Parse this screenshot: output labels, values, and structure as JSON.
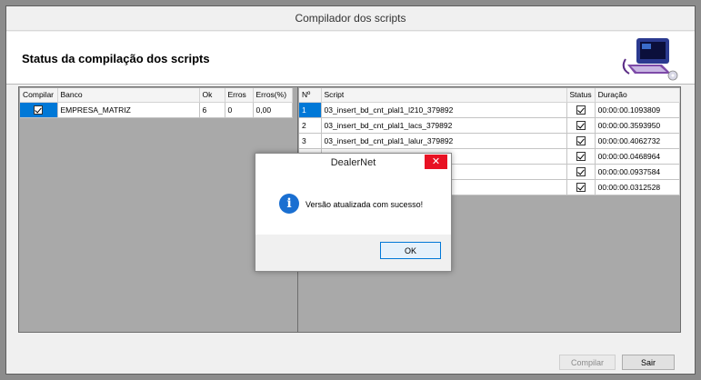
{
  "window": {
    "title": "Compilador dos scripts",
    "header_title": "Status da compilação dos scripts"
  },
  "banks_table": {
    "headers": [
      "Compilar",
      "Banco",
      "Ok",
      "Erros",
      "Erros(%)"
    ],
    "rows": [
      {
        "compilar": true,
        "banco": "EMPRESA_MATRIZ",
        "ok": "6",
        "erros": "0",
        "erros_pct": "0,00"
      }
    ]
  },
  "scripts_table": {
    "headers": [
      "Nº",
      "Script",
      "Status",
      "Duração"
    ],
    "rows": [
      {
        "n": "1",
        "script": "03_insert_bd_cnt_plal1_l210_379892",
        "status": true,
        "duracao": "00:00:00.1093809"
      },
      {
        "n": "2",
        "script": "03_insert_bd_cnt_plal1_lacs_379892",
        "status": true,
        "duracao": "00:00:00.3593950"
      },
      {
        "n": "3",
        "script": "03_insert_bd_cnt_plal1_lalur_379892",
        "status": true,
        "duracao": "00:00:00.4062732"
      },
      {
        "n": "",
        "script": "",
        "status": true,
        "duracao": "00:00:00.0468964"
      },
      {
        "n": "",
        "script": "",
        "status": true,
        "duracao": "00:00:00.0937584"
      },
      {
        "n": "",
        "script": "",
        "status": true,
        "duracao": "00:00:00.0312528"
      }
    ]
  },
  "buttons": {
    "compilar": "Compilar",
    "sair": "Sair"
  },
  "dialog": {
    "title": "DealerNet",
    "close": "✕",
    "message": "Versão atualizada com sucesso!",
    "ok": "OK",
    "icon": "info-icon"
  }
}
